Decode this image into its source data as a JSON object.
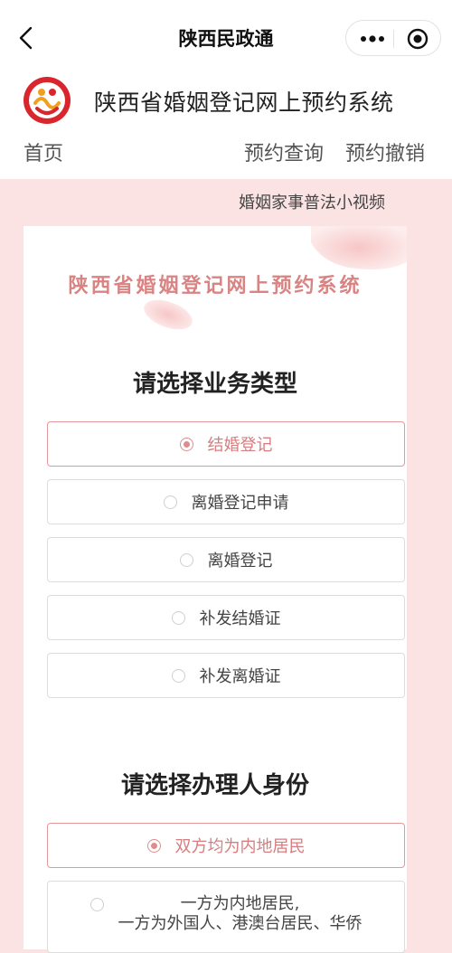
{
  "topbar": {
    "title": "陕西民政通",
    "back_icon": "chevron-left-icon",
    "more_icon": "more-dots-icon",
    "close_icon": "target-close-icon"
  },
  "header": {
    "system_title": "陕西省婚姻登记网上预约系统",
    "logo_icon": "marriage-registration-logo",
    "nav": {
      "home": "首页",
      "query": "预约查询",
      "cancel": "预约撤销"
    }
  },
  "video_link": "婚姻家事普法小视频",
  "banner": {
    "text": "陕西省婚姻登记网上预约系统"
  },
  "business": {
    "title": "请选择业务类型",
    "options": [
      {
        "label": "结婚登记",
        "selected": true
      },
      {
        "label": "离婚登记申请",
        "selected": false
      },
      {
        "label": "离婚登记",
        "selected": false
      },
      {
        "label": "补发结婚证",
        "selected": false
      },
      {
        "label": "补发离婚证",
        "selected": false
      }
    ]
  },
  "identity": {
    "title": "请选择办理人身份",
    "options": [
      {
        "label": "双方均为内地居民",
        "selected": true
      },
      {
        "label_line1": "一方为内地居民,",
        "label_line2": "一方为外国人、港澳台居民、华侨",
        "selected": false
      }
    ]
  },
  "colors": {
    "accent": "#e08c8f",
    "page_bg": "#fbe3e3",
    "banner_text": "#d98383"
  }
}
